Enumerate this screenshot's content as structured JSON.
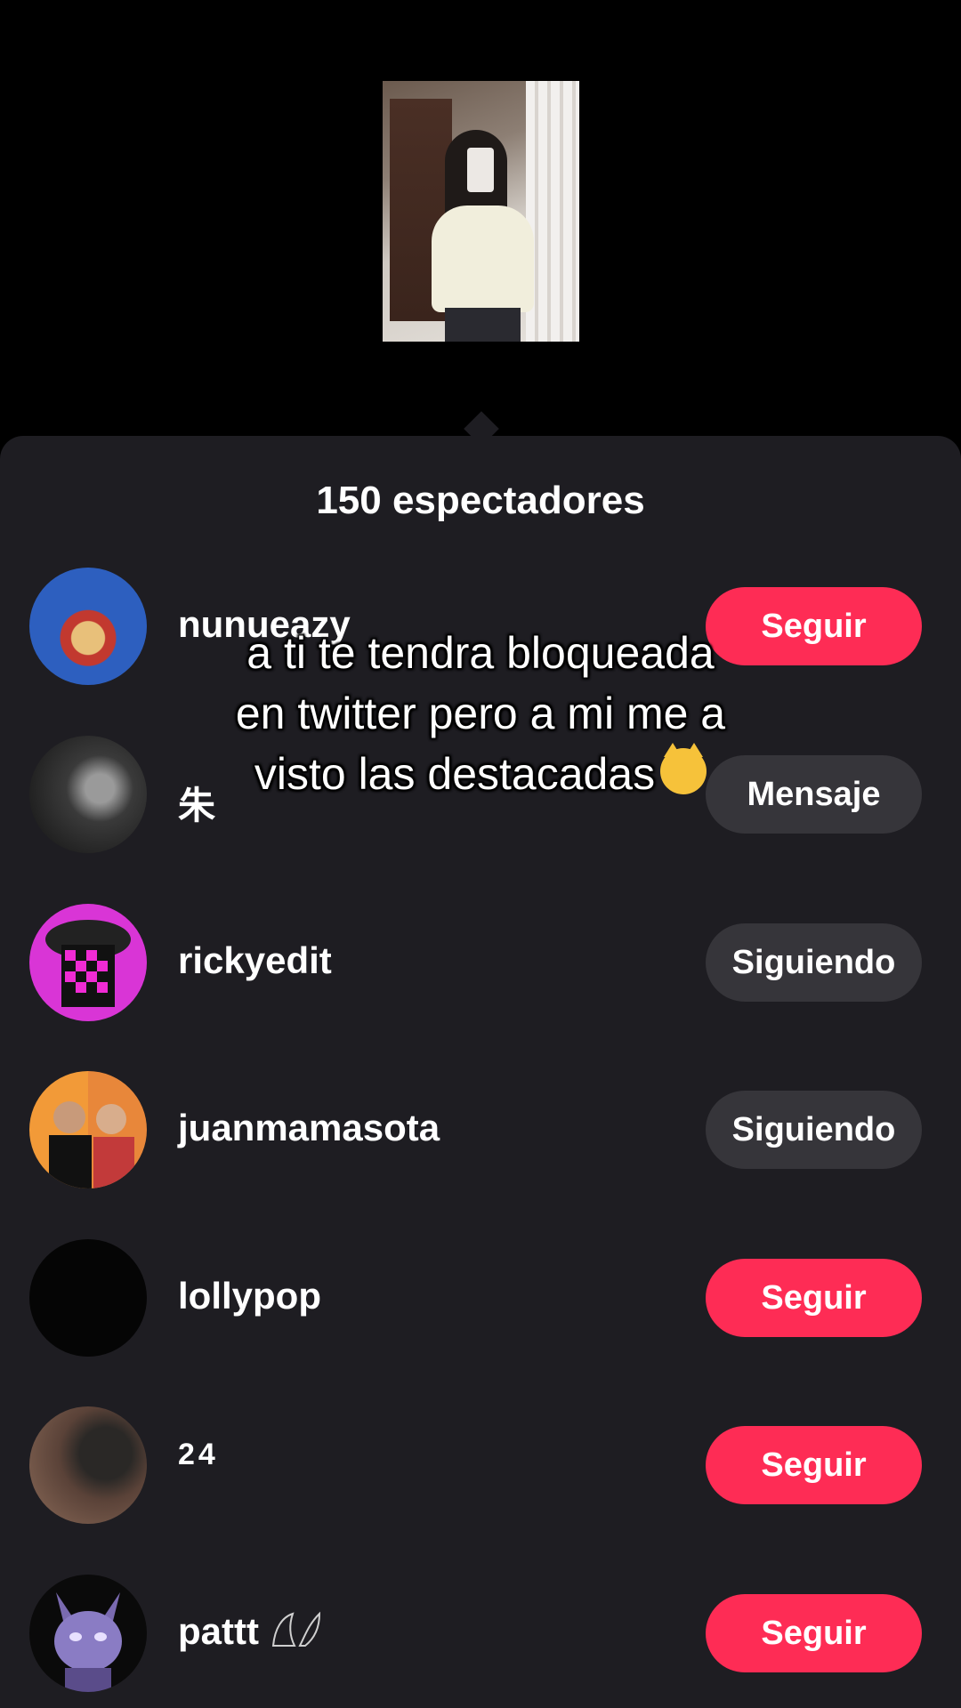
{
  "viewers_panel": {
    "title": "150 espectadores"
  },
  "caption": {
    "line1": "a ti te tendra bloqueada",
    "line2": "en twitter pero a mi me a",
    "line3": "visto las destacadas",
    "emoji": "kissing-cat-emoji"
  },
  "viewers": [
    {
      "username": "nunueazy",
      "button": "Seguir",
      "button_type": "follow"
    },
    {
      "username": "朱",
      "button": "Mensaje",
      "button_type": "gray"
    },
    {
      "username": "rickyedit",
      "button": "Siguiendo",
      "button_type": "gray"
    },
    {
      "username": "juanmamasota",
      "button": "Siguiendo",
      "button_type": "gray"
    },
    {
      "username": "lollypop",
      "button": "Seguir",
      "button_type": "follow"
    },
    {
      "username": "24",
      "button": "Seguir",
      "button_type": "follow"
    },
    {
      "username": "pattt",
      "button": "Seguir",
      "button_type": "follow"
    }
  ],
  "colors": {
    "follow": "#fe2c55",
    "gray": "#36353a",
    "panel": "#1e1d22"
  }
}
